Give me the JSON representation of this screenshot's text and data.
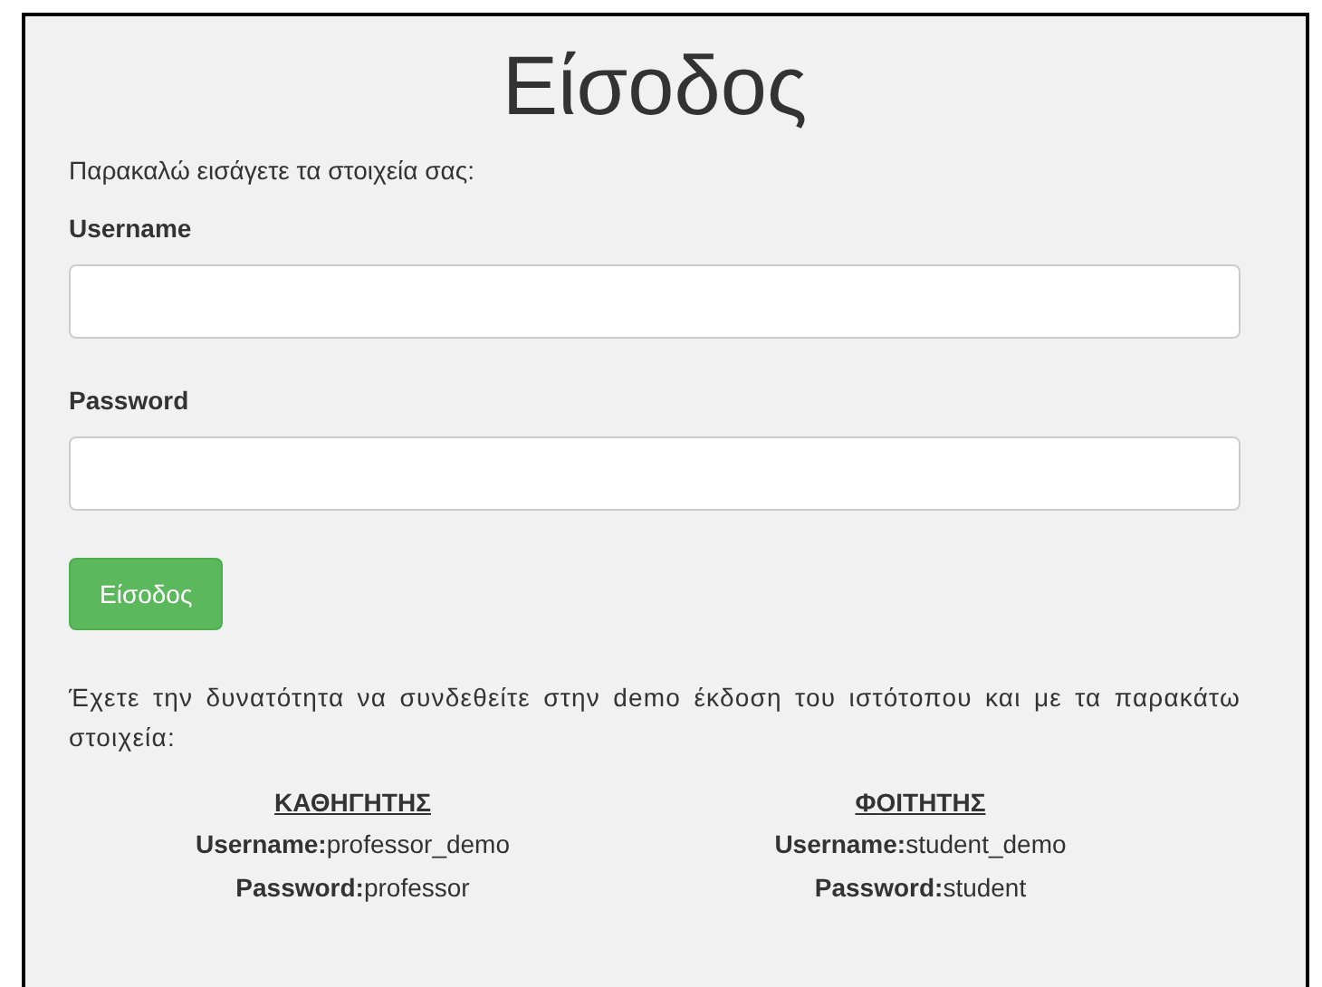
{
  "title": "Είσοδος",
  "intro": "Παρακαλώ εισάγετε τα στοιχεία σας:",
  "fields": [
    {
      "label": "Username"
    },
    {
      "label": "Password"
    }
  ],
  "submit_button": "Είσοδος",
  "demo_note": "Έχετε την δυνατότητα να συνδεθείτε στην demo έκδοση του ιστότοπου και με τα παρακάτω στοιχεία:",
  "demo_accounts": [
    {
      "heading": "ΚΑΘΗΓΗΤΗΣ",
      "lines": [
        "**Username:**professor_demo",
        "**Password:**professor"
      ]
    },
    {
      "heading": "ΦΟΙΤΗΤΗΣ",
      "lines": [
        "**Username:**student_demo",
        "**Password:**student"
      ]
    }
  ]
}
